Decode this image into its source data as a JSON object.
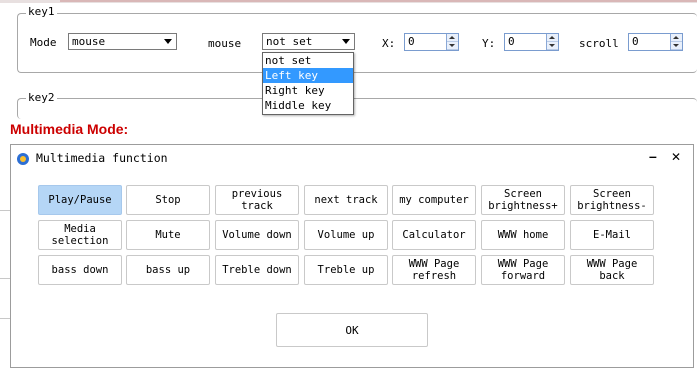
{
  "key1": {
    "legend": "key1",
    "mode_label": "Mode",
    "mode_value": "mouse",
    "type_label": "mouse",
    "mouse_value": "not set",
    "x_label": "X:",
    "x_value": "0",
    "y_label": "Y:",
    "y_value": "0",
    "scroll_label": "scroll",
    "scroll_value": "0"
  },
  "mouse_dropdown": {
    "options": [
      "not set",
      "Left key",
      "Right key",
      "Middle key"
    ],
    "highlighted": "Left key"
  },
  "key2": {
    "legend": "key2"
  },
  "section_title": "Multimedia Mode:",
  "dialog": {
    "title": "Multimedia function",
    "minimize": "–",
    "close": "✕",
    "buttons": [
      [
        "Play/Pause",
        "Stop",
        "previous track",
        "next track",
        "my computer",
        "Screen brightness+",
        "Screen brightness-"
      ],
      [
        "Media selection",
        "Mute",
        "Volume down",
        "Volume up",
        "Calculator",
        "WWW home",
        "E-Mail"
      ],
      [
        "bass down",
        "bass up",
        "Treble down",
        "Treble up",
        "WWW Page refresh",
        "WWW Page forward",
        "WWW Page back"
      ]
    ],
    "active_button": "Play/Pause",
    "ok_label": "OK"
  },
  "colors": {
    "selection": "#3399ff",
    "active_button": "#b5d6f6",
    "section_title": "#cc0000"
  }
}
